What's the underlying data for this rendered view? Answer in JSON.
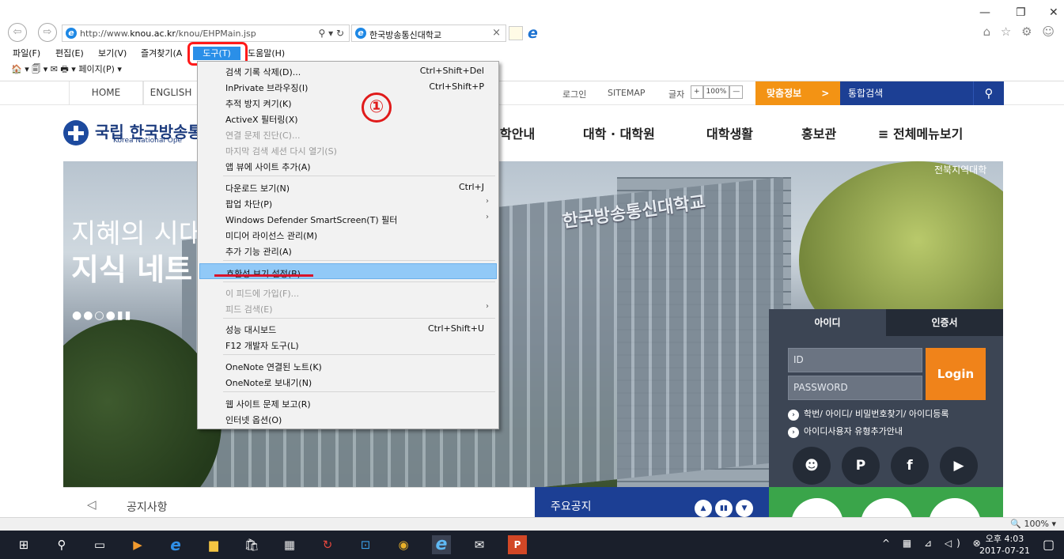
{
  "browser": {
    "url_prefix": "http://www.",
    "url_domain": "knou.ac.kr",
    "url_path": "/knou/EHPMain.jsp",
    "addr_tools": "⚲ ▾ ↻",
    "tab_title": "한국방송통신대학교",
    "tab_close": "×",
    "win_min": "—",
    "win_max": "❐",
    "win_close": "✕",
    "right_icons": "⌂ ☆ ⚙ ☺"
  },
  "menubar": {
    "file": "파일(F)",
    "edit": "편집(E)",
    "view": "보기(V)",
    "favorites": "즐겨찾기(A",
    "tools": "도구(T)",
    "help": "도움말(H)"
  },
  "cmdbar": "🏠 ▾ 🗐 ▾ ✉ 🖶 ▾ 페이지(P) ▾",
  "tools_menu": {
    "items": [
      {
        "label": "검색 기록 삭제(D)...",
        "shortcut": "Ctrl+Shift+Del",
        "disabled": false
      },
      {
        "label": "InPrivate 브라우징(I)",
        "shortcut": "Ctrl+Shift+P",
        "disabled": false
      },
      {
        "label": "추적 방지 켜기(K)",
        "shortcut": "",
        "disabled": false
      },
      {
        "label": "ActiveX 필터링(X)",
        "shortcut": "",
        "disabled": false
      },
      {
        "label": "연결 문제 진단(C)...",
        "shortcut": "",
        "disabled": true
      },
      {
        "label": "마지막 검색 세션 다시 열기(S)",
        "shortcut": "",
        "disabled": true
      },
      {
        "label": "앱 뷰에 사이트 추가(A)",
        "shortcut": "",
        "disabled": false
      },
      {
        "label": "다운로드 보기(N)",
        "shortcut": "Ctrl+J",
        "disabled": false
      },
      {
        "label": "팝업 차단(P)",
        "shortcut": "",
        "disabled": false
      },
      {
        "label": "Windows Defender SmartScreen(T) 필터",
        "shortcut": "",
        "disabled": false
      },
      {
        "label": "미디어 라이선스 관리(M)",
        "shortcut": "",
        "disabled": false
      },
      {
        "label": "추가 기능 관리(A)",
        "shortcut": "",
        "disabled": false
      },
      {
        "label": "호환성 보기 설정(B)",
        "shortcut": "",
        "disabled": false
      },
      {
        "label": "이 피드에 가입(F)...",
        "shortcut": "",
        "disabled": true
      },
      {
        "label": "피드 검색(E)",
        "shortcut": "",
        "disabled": true
      },
      {
        "label": "성능 대시보드",
        "shortcut": "Ctrl+Shift+U",
        "disabled": false
      },
      {
        "label": "F12 개발자 도구(L)",
        "shortcut": "",
        "disabled": false
      },
      {
        "label": "OneNote 연결된 노트(K)",
        "shortcut": "",
        "disabled": false
      },
      {
        "label": "OneNote로 보내기(N)",
        "shortcut": "",
        "disabled": false
      },
      {
        "label": "웹 사이트 문제 보고(R)",
        "shortcut": "",
        "disabled": false
      },
      {
        "label": "인터넷 옵션(O)",
        "shortcut": "",
        "disabled": false
      }
    ],
    "submenu_arrow": "›",
    "highlighted": "호환성 보기 설정(B)"
  },
  "annotation": {
    "step": "①"
  },
  "site": {
    "topnav": {
      "home": "HOME",
      "english": "ENGLISH",
      "login": "로그인",
      "sitemap": "SITEMAP",
      "fontsize": "글자",
      "plus": "+",
      "zoom": "100%",
      "minus": "—"
    },
    "custom_info": "맞춤정보",
    "custom_arrow": ">",
    "search_label": "통합검색",
    "search_icon": "⚲",
    "logo_text": "국립 한국방송통신",
    "logo_sub": "Korea National Ope",
    "gnb": [
      "학안내",
      "대학 · 대학원",
      "대학생활",
      "홍보관",
      "≡ 전체메뉴보기"
    ],
    "hero": {
      "line1": "지혜의 시대",
      "line2": "지식 네트",
      "tag": "전북지역대학",
      "sign": "한국방송통신대학교",
      "dots": "●●○●▮▮"
    },
    "login_panel": {
      "tab_id": "아이디",
      "tab_cert": "인증서",
      "id_placeholder": "ID",
      "pw_placeholder": "PASSWORD",
      "login_btn": "Login",
      "link1": "학번/ 아이디/ 비밀번호찾기/ 아이디등록",
      "link2": "아이디사용자 유형추가안내"
    },
    "sns": [
      "☻",
      "P",
      "f",
      "▶"
    ],
    "notice_title": "공지사항",
    "notice_icon": "◁",
    "major_title": "주요공지",
    "major_ctl": [
      "▲",
      "▮▮",
      "▼"
    ]
  },
  "statusbar": {
    "zoom": "🔍 100%  ▾"
  },
  "taskbar": {
    "icons": [
      "⊞",
      "⚲",
      "▭",
      "▶",
      "e",
      "▆",
      "🛍",
      "▦",
      "↻",
      "⊡",
      "◉",
      "e",
      "✉",
      "P"
    ],
    "tray": "^ ▦ ⊿ ◁) ⊗",
    "time": "오후 4:03",
    "date": "2017-07-21",
    "notif": "▢"
  },
  "colors": {
    "accent_tools": "#2a8fe8",
    "annotation_red": "#ff1a1a",
    "site_navy": "#1c3f94",
    "site_orange": "#f39314"
  }
}
